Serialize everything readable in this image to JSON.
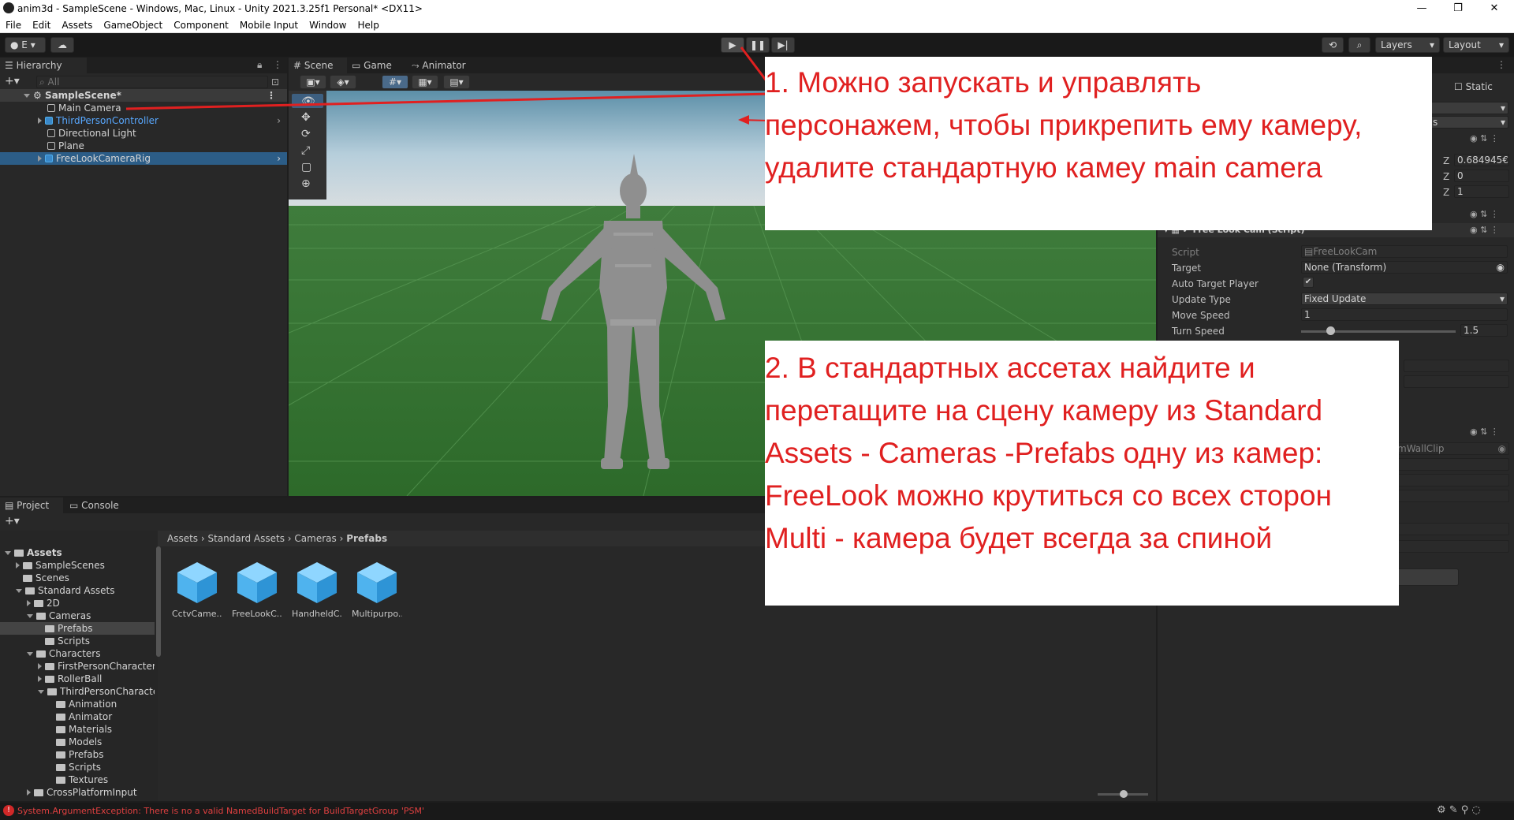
{
  "window": {
    "title": "anim3d - SampleScene - Windows, Mac, Linux - Unity 2021.3.25f1 Personal* <DX11>",
    "controls": [
      "—",
      "❐",
      "✕"
    ]
  },
  "menu": [
    "File",
    "Edit",
    "Assets",
    "GameObject",
    "Component",
    "Mobile Input",
    "Window",
    "Help"
  ],
  "toolbar": {
    "account_label": "E",
    "layers_label": "Layers",
    "layout_label": "Layout"
  },
  "hierarchy": {
    "tab": "Hierarchy",
    "search_placeholder": "All",
    "scene": "SampleScene*",
    "items": [
      {
        "label": "Main Camera",
        "color": "#d4d4d4"
      },
      {
        "label": "ThirdPersonController",
        "color": "#58a8ff"
      },
      {
        "label": "Directional Light",
        "color": "#d4d4d4"
      },
      {
        "label": "Plane",
        "color": "#d4d4d4"
      },
      {
        "label": "FreeLookCameraRig",
        "color": "#d4d4d4"
      }
    ]
  },
  "scene_tabs": [
    "Scene",
    "Game",
    "Animator"
  ],
  "project": {
    "tabs": [
      "Project",
      "Console"
    ],
    "breadcrumb": [
      "Assets",
      "Standard Assets",
      "Cameras",
      "Prefabs"
    ],
    "tree": [
      {
        "label": "Assets",
        "depth": 0,
        "open": true,
        "bold": true
      },
      {
        "label": "SampleScenes",
        "depth": 1,
        "open": false
      },
      {
        "label": "Scenes",
        "depth": 1,
        "open": null
      },
      {
        "label": "Standard Assets",
        "depth": 1,
        "open": true
      },
      {
        "label": "2D",
        "depth": 2,
        "open": false
      },
      {
        "label": "Cameras",
        "depth": 2,
        "open": true
      },
      {
        "label": "Prefabs",
        "depth": 3,
        "open": null,
        "selected": true
      },
      {
        "label": "Scripts",
        "depth": 3,
        "open": null
      },
      {
        "label": "Characters",
        "depth": 2,
        "open": true
      },
      {
        "label": "FirstPersonCharacter",
        "depth": 3,
        "open": false
      },
      {
        "label": "RollerBall",
        "depth": 3,
        "open": false
      },
      {
        "label": "ThirdPersonCharacte",
        "depth": 3,
        "open": true
      },
      {
        "label": "Animation",
        "depth": 4,
        "open": null
      },
      {
        "label": "Animator",
        "depth": 4,
        "open": null
      },
      {
        "label": "Materials",
        "depth": 4,
        "open": null
      },
      {
        "label": "Models",
        "depth": 4,
        "open": null
      },
      {
        "label": "Prefabs",
        "depth": 4,
        "open": null
      },
      {
        "label": "Scripts",
        "depth": 4,
        "open": null
      },
      {
        "label": "Textures",
        "depth": 4,
        "open": null
      },
      {
        "label": "CrossPlatformInput",
        "depth": 2,
        "open": false
      }
    ],
    "assets": [
      "CctvCame...",
      "FreeLookC...",
      "HandheldC...",
      "Multipurpo..."
    ]
  },
  "inspector": {
    "static_label": "Static",
    "transform": {
      "z1": "0.684945€",
      "z2": "0",
      "z3": "1"
    },
    "component_title": "Free Look Cam (Script)",
    "fields": [
      {
        "label": "Script",
        "value": "FreeLookCam"
      },
      {
        "label": "Target",
        "value": "None (Transform)"
      },
      {
        "label": "Auto Target Player",
        "value": "✔"
      },
      {
        "label": "Update Type",
        "value": "Fixed Update"
      },
      {
        "label": "Move Speed",
        "value": "1"
      },
      {
        "label": "Turn Speed",
        "value": "1.5"
      }
    ],
    "partial_field": "mWallClip",
    "partial_dropdown": "s"
  },
  "notes": {
    "note1": [
      "1. Можно запускать и управлять",
      "персонажем, чтобы прикрепить ему камеру,",
      "удалите стандартную камеу main camera"
    ],
    "note2": [
      "2. В стандартных ассетах найдите и",
      "перетащите на сцену камеру из Standard",
      "Assets - Cameras -Prefabs одну из камер:",
      "FreeLook можно крутиться со всех сторон",
      "Multi - камера будет всегда за спиной"
    ]
  },
  "status": {
    "error": "System.ArgumentException: There is no a valid NamedBuildTarget for BuildTargetGroup 'PSM'"
  }
}
